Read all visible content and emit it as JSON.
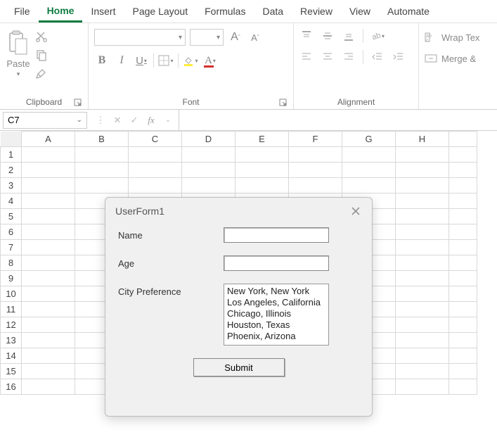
{
  "menu": {
    "tabs": [
      "File",
      "Home",
      "Insert",
      "Page Layout",
      "Formulas",
      "Data",
      "Review",
      "View",
      "Automate"
    ],
    "active": "Home"
  },
  "ribbon": {
    "clipboard": {
      "label": "Clipboard",
      "paste": "Paste"
    },
    "font": {
      "label": "Font",
      "bold": "B",
      "italic": "I",
      "underline": "U",
      "inc": "A",
      "dec": "A",
      "fontcolor": "A"
    },
    "alignment": {
      "label": "Alignment",
      "wrap": "Wrap Tex",
      "merge": "Merge &"
    }
  },
  "namebox": {
    "value": "C7"
  },
  "formula_bar": {
    "fx": "fx",
    "value": ""
  },
  "columns": [
    "A",
    "B",
    "C",
    "D",
    "E",
    "F",
    "G",
    "H"
  ],
  "rows": [
    "1",
    "2",
    "3",
    "4",
    "5",
    "6",
    "7",
    "8",
    "9",
    "10",
    "11",
    "12",
    "13",
    "14",
    "15",
    "16"
  ],
  "userform": {
    "title": "UserForm1",
    "fields": {
      "name_label": "Name",
      "age_label": "Age",
      "city_label": "City Preference"
    },
    "name_value": "",
    "age_value": "",
    "cities": [
      "New York, New York",
      "Los Angeles, California",
      "Chicago, Illinois",
      "Houston, Texas",
      "Phoenix, Arizona"
    ],
    "submit": "Submit"
  }
}
